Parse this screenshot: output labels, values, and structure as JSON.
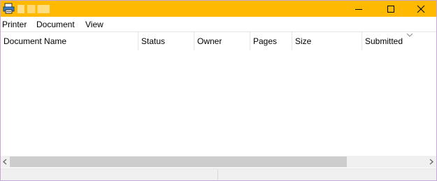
{
  "window": {
    "title": ""
  },
  "colors": {
    "titlebar": "#ffb900",
    "window_border": "#c5a8d6"
  },
  "icons": {
    "app": "printer-icon",
    "minimize": "minimize-icon",
    "maximize": "maximize-icon",
    "close": "close-icon",
    "sort": "sort-descending-icon",
    "scroll_left": "chevron-left-icon",
    "scroll_right": "chevron-right-icon"
  },
  "menu": {
    "printer": "Printer",
    "document": "Document",
    "view": "View"
  },
  "columns": {
    "name": "Document Name",
    "status": "Status",
    "owner": "Owner",
    "pages": "Pages",
    "size": "Size",
    "submitted": "Submitted"
  },
  "documents": [],
  "status": {
    "left": "",
    "right": ""
  }
}
